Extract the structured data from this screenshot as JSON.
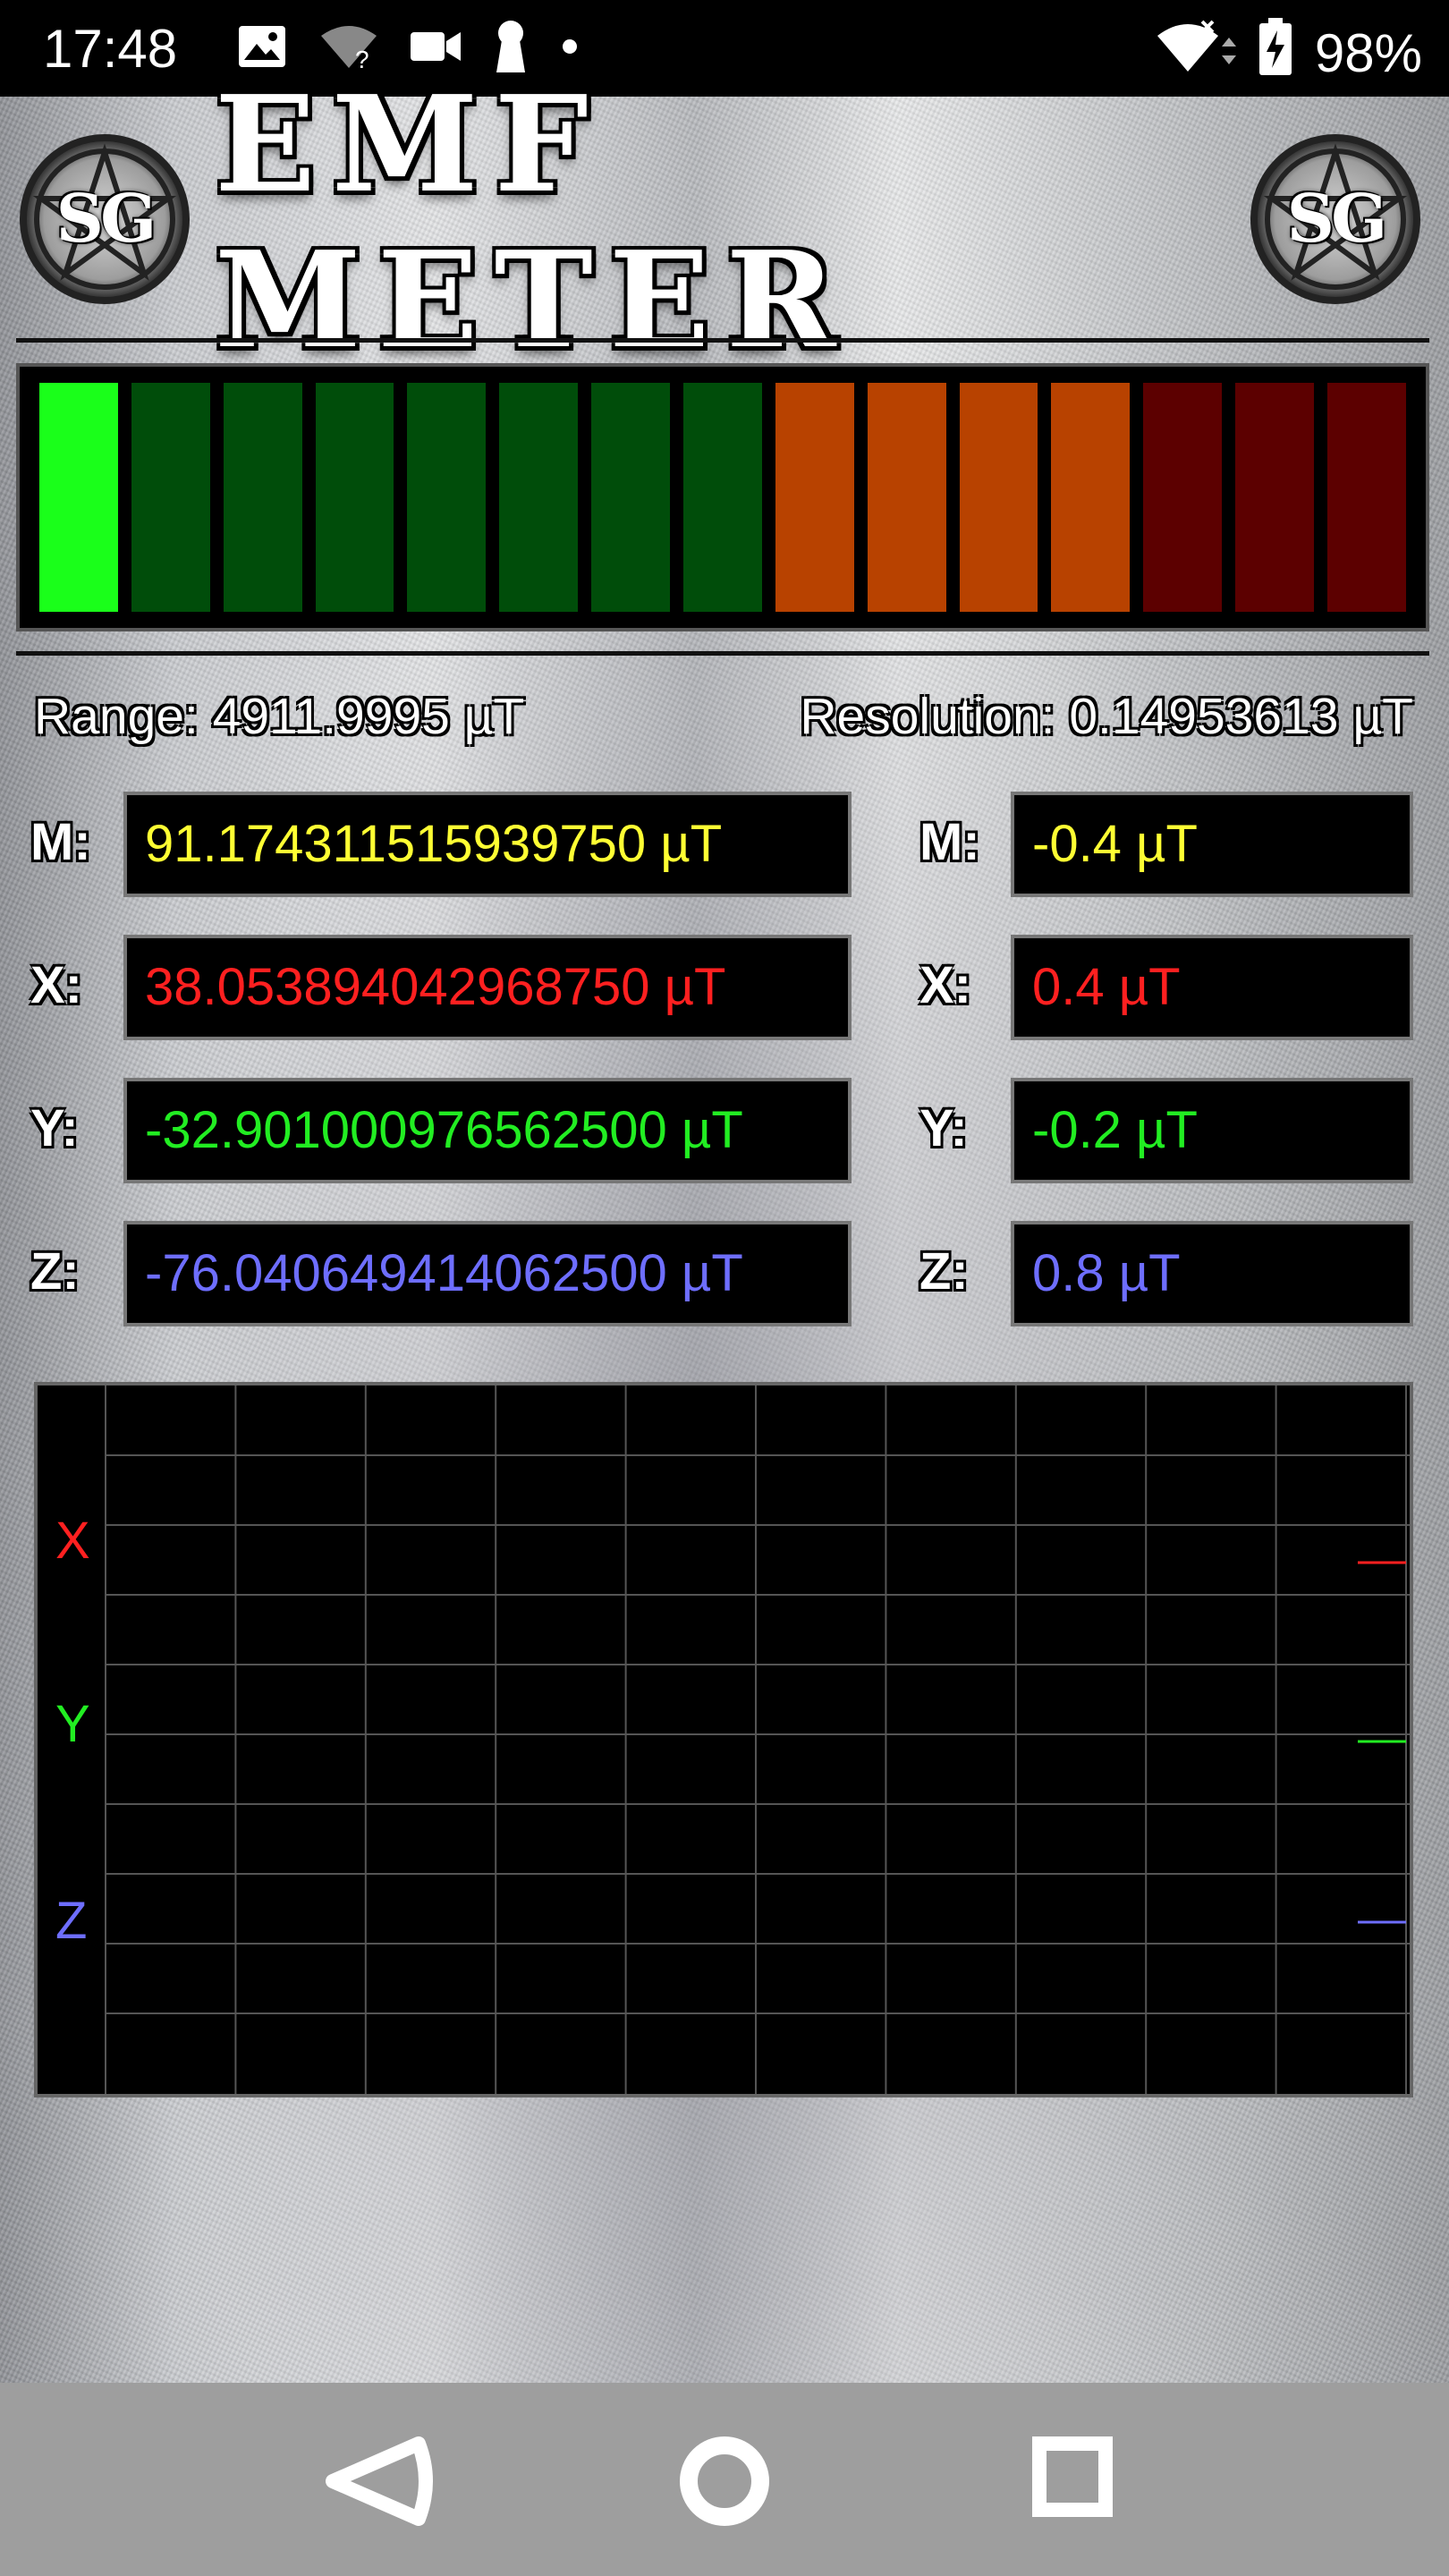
{
  "status_bar": {
    "time": "17:48",
    "left_icons": [
      "gallery-icon",
      "wifi-unknown-icon",
      "video-camera-icon",
      "keyhole-icon",
      "dot-icon"
    ],
    "right_icons": [
      "wifi-x-icon",
      "battery-charging-icon"
    ],
    "battery": "98%"
  },
  "header": {
    "title": "EMF METER",
    "logo_text": "SG"
  },
  "meter": {
    "active_segments": 1,
    "total_segments": 15,
    "colors": {
      "green_on": "#1aff1a",
      "green_off": "#004d0a",
      "orange": "#b84200",
      "red": "#5c0000"
    }
  },
  "info": {
    "range": "Range: 4911.9995 µT",
    "resolution": "Resolution: 0.14953613 µT"
  },
  "readings": {
    "left": [
      {
        "label": "M:",
        "value": "91.174311515939750 µT",
        "color": "#ffff33"
      },
      {
        "label": "X:",
        "value": "38.053894042968750 µT",
        "color": "#ff2020"
      },
      {
        "label": "Y:",
        "value": "-32.901000976562500 µT",
        "color": "#22ee22"
      },
      {
        "label": "Z:",
        "value": "-76.040649414062500 µT",
        "color": "#6e6eff"
      }
    ],
    "right": [
      {
        "label": "M:",
        "value": "-0.4 µT",
        "color": "#ffff33"
      },
      {
        "label": "X:",
        "value": "0.4 µT",
        "color": "#ff2020"
      },
      {
        "label": "Y:",
        "value": "-0.2 µT",
        "color": "#22ee22"
      },
      {
        "label": "Z:",
        "value": "0.8 µT",
        "color": "#6e6eff"
      }
    ]
  },
  "graph": {
    "x_label": "X",
    "y_label": "Y",
    "z_label": "Z",
    "x_color": "#ff2020",
    "y_color": "#22ee22",
    "z_color": "#6e6eff"
  },
  "navbar": {
    "back": "back-icon",
    "home": "home-icon",
    "recents": "recents-icon"
  }
}
